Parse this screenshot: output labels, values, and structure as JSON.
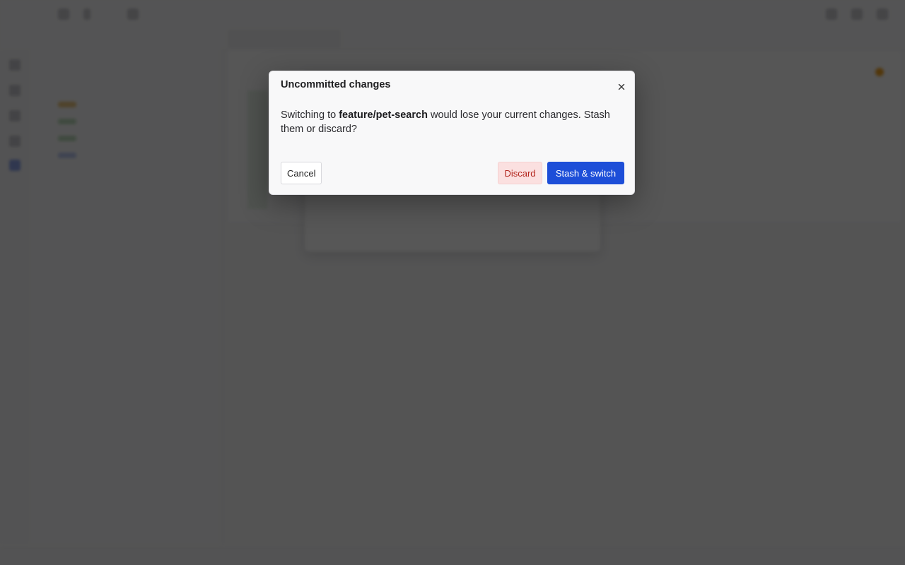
{
  "modal": {
    "title": "Uncommitted changes",
    "body_prefix": "Switching to ",
    "branch_name": "feature/pet-search",
    "body_suffix": " would lose your current changes. Stash them or discard?",
    "buttons": {
      "cancel": "Cancel",
      "discard": "Discard",
      "stash": "Stash & switch"
    }
  },
  "colors": {
    "primary": "#1d4ed8",
    "danger_bg": "#fbe0e0",
    "danger_text": "#b3261e",
    "overlay": "rgba(0,0,0,0.66)"
  },
  "icons": {
    "close": "close-icon"
  }
}
